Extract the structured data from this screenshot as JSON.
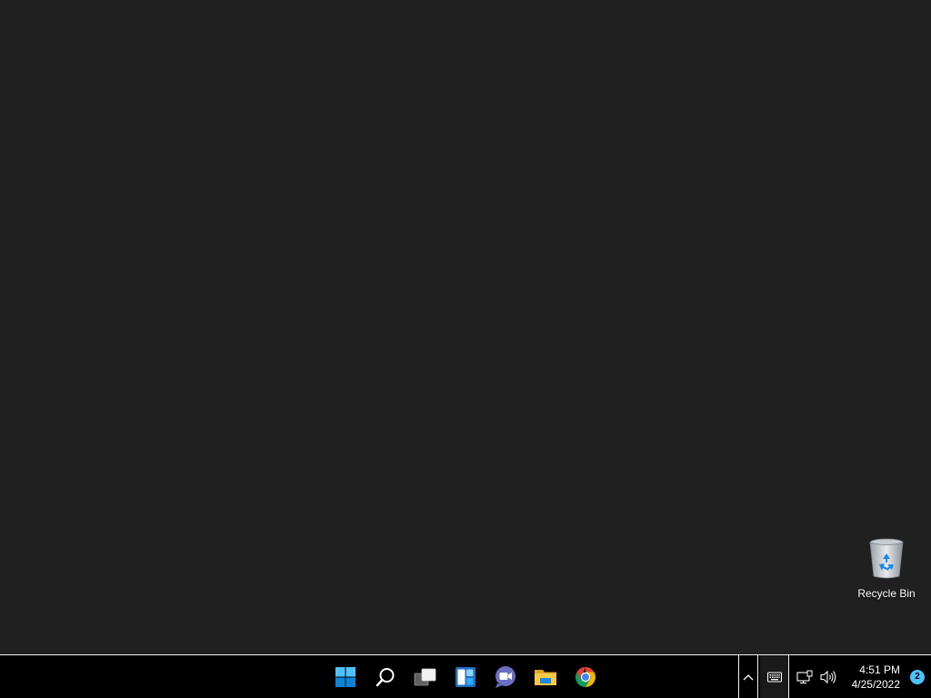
{
  "desktop": {
    "background_color": "#202020",
    "icons": [
      {
        "label": "Recycle Bin",
        "icon": "recycle-bin-icon"
      }
    ]
  },
  "taskbar": {
    "pinned_apps": [
      {
        "name": "Start",
        "icon": "windows-start-icon",
        "color": "#0078d4"
      },
      {
        "name": "Search",
        "icon": "search-icon",
        "color": "#ffffff"
      },
      {
        "name": "Task View",
        "icon": "task-view-icon",
        "color": "#ffffff"
      },
      {
        "name": "Widgets",
        "icon": "widgets-icon",
        "color": "#2f8fd8"
      },
      {
        "name": "Chat",
        "icon": "chat-icon",
        "color": "#6264a7"
      },
      {
        "name": "File Explorer",
        "icon": "folder-icon",
        "color": "#f3c23f"
      },
      {
        "name": "Google Chrome",
        "icon": "chrome-icon",
        "color": "#db4437"
      }
    ],
    "tray": {
      "overflow_icon": "chevron-up-icon",
      "keyboard_icon": "keyboard-icon",
      "network_icon": "network-icon",
      "volume_icon": "volume-icon"
    },
    "clock": {
      "time": "4:51 PM",
      "date": "4/25/2022"
    },
    "notifications": {
      "count": "2",
      "badge_color": "#4cc2ff"
    }
  }
}
